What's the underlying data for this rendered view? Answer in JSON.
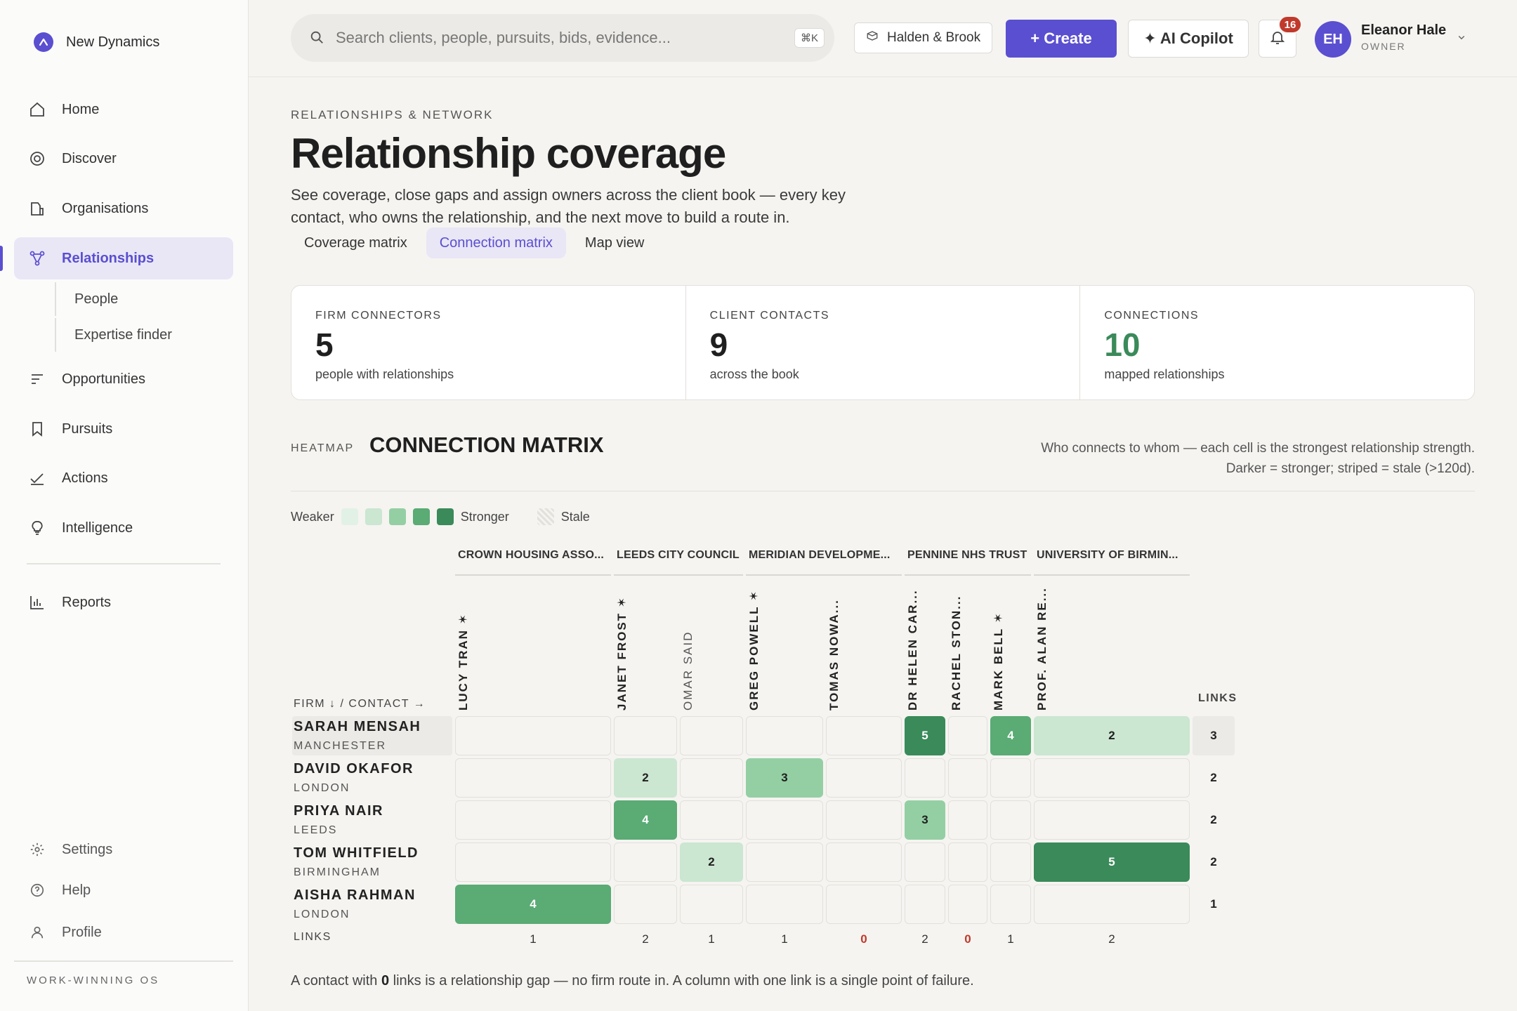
{
  "sidebar": {
    "brand": "New Dynamics",
    "items": [
      {
        "label": "Home",
        "icon": "home-icon"
      },
      {
        "label": "Discover",
        "icon": "discover-icon"
      },
      {
        "label": "Organisations",
        "icon": "building-icon"
      },
      {
        "label": "Relationships",
        "icon": "network-icon",
        "active": true
      },
      {
        "label": "Opportunities",
        "icon": "list-icon"
      },
      {
        "label": "Pursuits",
        "icon": "bookmark-icon"
      },
      {
        "label": "Actions",
        "icon": "check-icon"
      },
      {
        "label": "Intelligence",
        "icon": "lightbulb-icon"
      },
      {
        "label": "Reports",
        "icon": "bar-chart-icon"
      }
    ],
    "sub_items": [
      "People",
      "Expertise finder"
    ],
    "bottom": [
      {
        "label": "Settings",
        "icon": "gear-icon"
      },
      {
        "label": "Help",
        "icon": "help-icon"
      },
      {
        "label": "Profile",
        "icon": "user-icon"
      }
    ],
    "footer": "WORK-WINNING OS"
  },
  "topbar": {
    "search_placeholder": "Search clients, people, pursuits, bids, evidence...",
    "shortcut": "⌘K",
    "org": "Halden & Brook",
    "create": "+ Create",
    "copilot": "✦ AI Copilot",
    "notifications": "16",
    "user": {
      "initials": "EH",
      "name": "Eleanor Hale",
      "role": "OWNER"
    }
  },
  "page": {
    "kicker": "RELATIONSHIPS & NETWORK",
    "title": "Relationship coverage",
    "description": "See coverage, close gaps and assign owners across the client book — every key contact, who owns the relationship, and the next move to build a route in.",
    "tabs": [
      {
        "label": "Coverage matrix"
      },
      {
        "label": "Connection matrix",
        "active": true
      },
      {
        "label": "Map view"
      }
    ]
  },
  "kpis": [
    {
      "label": "FIRM CONNECTORS",
      "value": "5",
      "sub": "people with relationships"
    },
    {
      "label": "CLIENT CONTACTS",
      "value": "9",
      "sub": "across the book"
    },
    {
      "label": "CONNECTIONS",
      "value": "10",
      "sub": "mapped relationships",
      "accent": "#3a8a5a"
    }
  ],
  "section": {
    "kicker": "HEATMAP",
    "title": "CONNECTION MATRIX",
    "note": "Who connects to whom — each cell is the strongest relationship strength. Darker = stronger; striped = stale (>120d)."
  },
  "legend": {
    "weaker": "Weaker",
    "stronger": "Stronger",
    "stale": "Stale",
    "scale_colors": [
      "#e2f1e5",
      "#cbe6d1",
      "#94cfa4",
      "#5aab74",
      "#3a8a5a"
    ]
  },
  "matrix": {
    "firm_header": "FIRM ↓ / CONTACT →",
    "links_header": "LINKS",
    "links_row_label": "LINKS",
    "groups": [
      "CROWN HOUSING ASSO...",
      "LEEDS CITY COUNCIL",
      "MERIDIAN DEVELOPME...",
      "PENNINE NHS TRUST",
      "UNIVERSITY OF BIRMIN..."
    ],
    "contacts": [
      {
        "name": "LUCY TRAN ✶",
        "group": 0
      },
      {
        "name": "JANET FROST ✶",
        "group": 1
      },
      {
        "name": "OMAR SAID",
        "group": 1,
        "dim": true
      },
      {
        "name": "GREG POWELL ✶",
        "group": 2
      },
      {
        "name": "TOMAS NOWA...",
        "group": 2
      },
      {
        "name": "DR HELEN CAR...",
        "group": 3
      },
      {
        "name": "RACHEL STON...",
        "group": 3
      },
      {
        "name": "MARK BELL ✶",
        "group": 3
      },
      {
        "name": "PROF. ALAN RE...",
        "group": 4
      }
    ],
    "rows": [
      {
        "name": "SARAH MENSAH",
        "city": "MANCHESTER",
        "cells": [
          0,
          0,
          0,
          0,
          0,
          5,
          0,
          4,
          2
        ],
        "links": "3"
      },
      {
        "name": "DAVID OKAFOR",
        "city": "LONDON",
        "cells": [
          0,
          2,
          0,
          3,
          0,
          0,
          0,
          0,
          0
        ],
        "links": "2"
      },
      {
        "name": "PRIYA NAIR",
        "city": "LEEDS",
        "cells": [
          0,
          4,
          0,
          0,
          0,
          3,
          0,
          0,
          0
        ],
        "links": "2"
      },
      {
        "name": "TOM WHITFIELD",
        "city": "BIRMINGHAM",
        "cells": [
          0,
          0,
          2,
          0,
          0,
          0,
          0,
          0,
          5
        ],
        "links": "2"
      },
      {
        "name": "AISHA RAHMAN",
        "city": "LONDON",
        "cells": [
          4,
          0,
          0,
          0,
          0,
          0,
          0,
          0,
          0
        ],
        "links": "1"
      }
    ],
    "col_links": [
      "1",
      "2",
      "1",
      "1",
      "0",
      "2",
      "0",
      "1",
      "2"
    ]
  },
  "footnote": {
    "pre": "A contact with ",
    "bold": "0",
    "post": " links is a relationship gap — no firm route in. A column with one link is a single point of failure."
  }
}
